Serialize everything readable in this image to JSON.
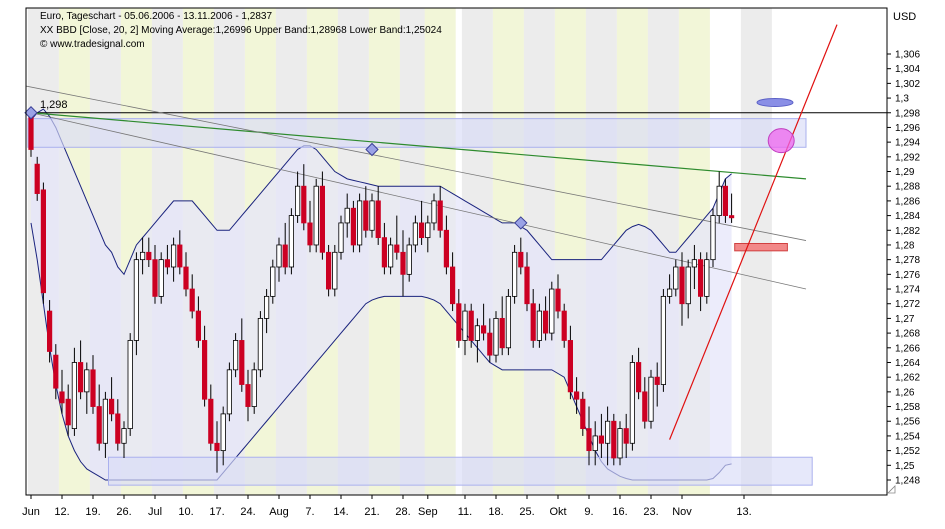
{
  "header": {
    "line1": "Euro, Tageschart - 05.06.2006 - 13.11.2006 - 1,2837",
    "line2": "XX BBD [Close, 20, 2] Moving Average:1,26996 Upper Band:1,28968 Lower Band:1,25024",
    "line3": "© www.tradesignal.com"
  },
  "currency_label": "USD",
  "level_label": "1,298",
  "colors": {
    "up": "#ffffff",
    "down": "#cc0022",
    "band": "#1a237e",
    "band_fill": "#e6e6fa",
    "stripe": "#ececec",
    "stripe_yellow": "#f2f6d8",
    "trend_green": "#2e8b2e",
    "trend_red": "#e01010",
    "trend_gray": "#777777",
    "level_line": "#000000",
    "box_blue": "#aab0ee",
    "ellipse_blue": "#8a8fe6",
    "ellipse_pink": "#ee66ee",
    "box_red": "#f28888"
  },
  "chart_data": {
    "type": "candlestick",
    "title": "Euro, Tageschart - 05.06.2006 - 13.11.2006 - 1,2837",
    "ylabel": "USD",
    "ylim": [
      1.247,
      1.309
    ],
    "y_ticks": [
      "1,306",
      "1,304",
      "1,302",
      "1,3",
      "1,298",
      "1,296",
      "1,294",
      "1,292",
      "1,29",
      "1,288",
      "1,286",
      "1,284",
      "1,282",
      "1,28",
      "1,278",
      "1,276",
      "1,274",
      "1,272",
      "1,27",
      "1,268",
      "1,266",
      "1,264",
      "1,262",
      "1,26",
      "1,258",
      "1,256",
      "1,254",
      "1,252",
      "1,25",
      "1,248"
    ],
    "x_ticks": [
      {
        "label": "Jun",
        "i": 0
      },
      {
        "label": "12.",
        "i": 5
      },
      {
        "label": "19.",
        "i": 10
      },
      {
        "label": "26.",
        "i": 15
      },
      {
        "label": "Jul",
        "i": 20
      },
      {
        "label": "10.",
        "i": 25
      },
      {
        "label": "17.",
        "i": 30
      },
      {
        "label": "24.",
        "i": 35
      },
      {
        "label": "Aug",
        "i": 40
      },
      {
        "label": "7.",
        "i": 45
      },
      {
        "label": "14.",
        "i": 50
      },
      {
        "label": "21.",
        "i": 55
      },
      {
        "label": "28.",
        "i": 60
      },
      {
        "label": "Sep",
        "i": 64
      },
      {
        "label": "11.",
        "i": 70
      },
      {
        "label": "18.",
        "i": 75
      },
      {
        "label": "25.",
        "i": 80
      },
      {
        "label": "Okt",
        "i": 85
      },
      {
        "label": "9.",
        "i": 90
      },
      {
        "label": "16.",
        "i": 95
      },
      {
        "label": "23.",
        "i": 100
      },
      {
        "label": "Nov",
        "i": 105
      },
      {
        "label": "13.",
        "i": 115
      }
    ],
    "candles": [
      [
        1.2975,
        1.298,
        1.292,
        1.293
      ],
      [
        1.291,
        1.292,
        1.286,
        1.287
      ],
      [
        1.2875,
        1.2885,
        1.272,
        1.2735
      ],
      [
        1.271,
        1.2725,
        1.264,
        1.2655
      ],
      [
        1.265,
        1.2665,
        1.259,
        1.2605
      ],
      [
        1.26,
        1.263,
        1.257,
        1.2585
      ],
      [
        1.259,
        1.261,
        1.254,
        1.2555
      ],
      [
        1.255,
        1.266,
        1.254,
        1.264
      ],
      [
        1.264,
        1.267,
        1.259,
        1.26
      ],
      [
        1.26,
        1.264,
        1.257,
        1.263
      ],
      [
        1.263,
        1.265,
        1.257,
        1.258
      ],
      [
        1.258,
        1.261,
        1.252,
        1.253
      ],
      [
        1.253,
        1.26,
        1.251,
        1.259
      ],
      [
        1.259,
        1.262,
        1.256,
        1.257
      ],
      [
        1.257,
        1.259,
        1.252,
        1.253
      ],
      [
        1.253,
        1.256,
        1.251,
        1.255
      ],
      [
        1.255,
        1.268,
        1.254,
        1.267
      ],
      [
        1.267,
        1.279,
        1.265,
        1.278
      ],
      [
        1.278,
        1.281,
        1.276,
        1.279
      ],
      [
        1.279,
        1.281,
        1.277,
        1.278
      ],
      [
        1.278,
        1.28,
        1.272,
        1.273
      ],
      [
        1.273,
        1.279,
        1.272,
        1.278
      ],
      [
        1.278,
        1.28,
        1.276,
        1.277
      ],
      [
        1.277,
        1.281,
        1.275,
        1.28
      ],
      [
        1.28,
        1.282,
        1.276,
        1.277
      ],
      [
        1.277,
        1.279,
        1.273,
        1.274
      ],
      [
        1.274,
        1.276,
        1.27,
        1.271
      ],
      [
        1.271,
        1.273,
        1.266,
        1.267
      ],
      [
        1.267,
        1.269,
        1.258,
        1.259
      ],
      [
        1.259,
        1.261,
        1.252,
        1.253
      ],
      [
        1.253,
        1.256,
        1.249,
        1.252
      ],
      [
        1.252,
        1.258,
        1.25,
        1.257
      ],
      [
        1.257,
        1.264,
        1.256,
        1.263
      ],
      [
        1.263,
        1.268,
        1.262,
        1.267
      ],
      [
        1.267,
        1.27,
        1.26,
        1.261
      ],
      [
        1.261,
        1.263,
        1.256,
        1.258
      ],
      [
        1.258,
        1.264,
        1.257,
        1.263
      ],
      [
        1.263,
        1.271,
        1.262,
        1.27
      ],
      [
        1.27,
        1.274,
        1.268,
        1.273
      ],
      [
        1.273,
        1.278,
        1.272,
        1.277
      ],
      [
        1.277,
        1.281,
        1.275,
        1.28
      ],
      [
        1.28,
        1.283,
        1.276,
        1.277
      ],
      [
        1.277,
        1.285,
        1.276,
        1.284
      ],
      [
        1.284,
        1.29,
        1.283,
        1.288
      ],
      [
        1.288,
        1.291,
        1.282,
        1.283
      ],
      [
        1.283,
        1.286,
        1.279,
        1.28
      ],
      [
        1.28,
        1.289,
        1.279,
        1.288
      ],
      [
        1.288,
        1.29,
        1.278,
        1.279
      ],
      [
        1.279,
        1.28,
        1.273,
        1.274
      ],
      [
        1.274,
        1.28,
        1.273,
        1.279
      ],
      [
        1.279,
        1.284,
        1.278,
        1.283
      ],
      [
        1.283,
        1.287,
        1.281,
        1.285
      ],
      [
        1.285,
        1.286,
        1.279,
        1.28
      ],
      [
        1.28,
        1.287,
        1.279,
        1.286
      ],
      [
        1.286,
        1.288,
        1.281,
        1.282
      ],
      [
        1.282,
        1.287,
        1.281,
        1.286
      ],
      [
        1.286,
        1.288,
        1.28,
        1.281
      ],
      [
        1.281,
        1.283,
        1.276,
        1.277
      ],
      [
        1.277,
        1.281,
        1.276,
        1.28
      ],
      [
        1.28,
        1.284,
        1.278,
        1.279
      ],
      [
        1.279,
        1.282,
        1.273,
        1.276
      ],
      [
        1.276,
        1.281,
        1.275,
        1.28
      ],
      [
        1.28,
        1.284,
        1.279,
        1.283
      ],
      [
        1.283,
        1.286,
        1.28,
        1.281
      ],
      [
        1.281,
        1.284,
        1.279,
        1.283
      ],
      [
        1.283,
        1.287,
        1.282,
        1.286
      ],
      [
        1.286,
        1.288,
        1.281,
        1.282
      ],
      [
        1.282,
        1.284,
        1.276,
        1.277
      ],
      [
        1.277,
        1.279,
        1.271,
        1.272
      ],
      [
        1.272,
        1.274,
        1.266,
        1.267
      ],
      [
        1.267,
        1.272,
        1.265,
        1.271
      ],
      [
        1.271,
        1.272,
        1.266,
        1.267
      ],
      [
        1.267,
        1.27,
        1.264,
        1.269
      ],
      [
        1.269,
        1.272,
        1.267,
        1.268
      ],
      [
        1.268,
        1.27,
        1.264,
        1.265
      ],
      [
        1.265,
        1.271,
        1.264,
        1.27
      ],
      [
        1.27,
        1.273,
        1.265,
        1.266
      ],
      [
        1.266,
        1.274,
        1.265,
        1.273
      ],
      [
        1.273,
        1.28,
        1.272,
        1.279
      ],
      [
        1.279,
        1.281,
        1.276,
        1.277
      ],
      [
        1.277,
        1.279,
        1.271,
        1.272
      ],
      [
        1.272,
        1.274,
        1.266,
        1.267
      ],
      [
        1.267,
        1.272,
        1.266,
        1.271
      ],
      [
        1.271,
        1.273,
        1.267,
        1.268
      ],
      [
        1.268,
        1.275,
        1.267,
        1.274
      ],
      [
        1.274,
        1.276,
        1.27,
        1.271
      ],
      [
        1.271,
        1.272,
        1.266,
        1.267
      ],
      [
        1.267,
        1.269,
        1.259,
        1.26
      ],
      [
        1.26,
        1.262,
        1.257,
        1.259
      ],
      [
        1.259,
        1.26,
        1.254,
        1.255
      ],
      [
        1.255,
        1.258,
        1.25,
        1.252
      ],
      [
        1.252,
        1.256,
        1.25,
        1.254
      ],
      [
        1.254,
        1.257,
        1.251,
        1.253
      ],
      [
        1.253,
        1.258,
        1.25,
        1.256
      ],
      [
        1.256,
        1.257,
        1.25,
        1.251
      ],
      [
        1.251,
        1.256,
        1.25,
        1.255
      ],
      [
        1.255,
        1.257,
        1.251,
        1.253
      ],
      [
        1.253,
        1.265,
        1.252,
        1.264
      ],
      [
        1.264,
        1.266,
        1.259,
        1.26
      ],
      [
        1.26,
        1.262,
        1.255,
        1.256
      ],
      [
        1.256,
        1.263,
        1.255,
        1.262
      ],
      [
        1.262,
        1.264,
        1.258,
        1.261
      ],
      [
        1.261,
        1.274,
        1.26,
        1.273
      ],
      [
        1.273,
        1.276,
        1.272,
        1.274
      ],
      [
        1.274,
        1.278,
        1.273,
        1.277
      ],
      [
        1.277,
        1.279,
        1.269,
        1.272
      ],
      [
        1.272,
        1.278,
        1.27,
        1.277
      ],
      [
        1.277,
        1.28,
        1.274,
        1.278
      ],
      [
        1.278,
        1.279,
        1.271,
        1.273
      ],
      [
        1.273,
        1.279,
        1.272,
        1.278
      ],
      [
        1.278,
        1.285,
        1.277,
        1.284
      ],
      [
        1.284,
        1.29,
        1.283,
        1.288
      ],
      [
        1.288,
        1.289,
        1.283,
        1.284
      ],
      [
        1.284,
        1.287,
        1.283,
        1.2837
      ]
    ],
    "upper_band": [
      1.297,
      1.298,
      1.2985,
      1.2975,
      1.296,
      1.294,
      1.292,
      1.29,
      1.288,
      1.286,
      1.284,
      1.282,
      1.28,
      1.279,
      1.277,
      1.276,
      1.278,
      1.28,
      1.281,
      1.282,
      1.283,
      1.284,
      1.285,
      1.286,
      1.286,
      1.286,
      1.286,
      1.285,
      1.284,
      1.283,
      1.282,
      1.282,
      1.282,
      1.283,
      1.284,
      1.285,
      1.286,
      1.287,
      1.288,
      1.289,
      1.29,
      1.291,
      1.292,
      1.293,
      1.2935,
      1.2935,
      1.293,
      1.292,
      1.291,
      1.29,
      1.2895,
      1.289,
      1.2888,
      1.2886,
      1.2884,
      1.2882,
      1.288,
      1.288,
      1.288,
      1.288,
      1.288,
      1.288,
      1.288,
      1.288,
      1.288,
      1.288,
      1.288,
      1.2875,
      1.287,
      1.2865,
      1.286,
      1.2855,
      1.285,
      1.2845,
      1.284,
      1.2835,
      1.283,
      1.283,
      1.283,
      1.2825,
      1.282,
      1.281,
      1.28,
      1.279,
      1.278,
      1.278,
      1.278,
      1.278,
      1.278,
      1.278,
      1.278,
      1.278,
      1.278,
      1.279,
      1.28,
      1.281,
      1.282,
      1.2825,
      1.2828,
      1.2825,
      1.282,
      1.281,
      1.28,
      1.279,
      1.279,
      1.28,
      1.281,
      1.282,
      1.283,
      1.284,
      1.285,
      1.287,
      1.289,
      1.2897
    ],
    "lower_band": [
      1.283,
      1.278,
      1.272,
      1.266,
      1.261,
      1.257,
      1.254,
      1.252,
      1.2505,
      1.2495,
      1.249,
      1.2485,
      1.248,
      1.248,
      1.248,
      1.248,
      1.248,
      1.248,
      1.248,
      1.248,
      1.248,
      1.248,
      1.248,
      1.248,
      1.248,
      1.248,
      1.248,
      1.248,
      1.248,
      1.248,
      1.248,
      1.249,
      1.25,
      1.251,
      1.252,
      1.253,
      1.254,
      1.255,
      1.256,
      1.257,
      1.258,
      1.259,
      1.26,
      1.261,
      1.262,
      1.263,
      1.264,
      1.265,
      1.266,
      1.267,
      1.268,
      1.269,
      1.27,
      1.271,
      1.272,
      1.2725,
      1.2728,
      1.273,
      1.273,
      1.273,
      1.273,
      1.273,
      1.273,
      1.273,
      1.2728,
      1.2725,
      1.272,
      1.271,
      1.27,
      1.269,
      1.268,
      1.267,
      1.266,
      1.265,
      1.264,
      1.2635,
      1.263,
      1.263,
      1.263,
      1.263,
      1.263,
      1.263,
      1.263,
      1.263,
      1.263,
      1.2625,
      1.262,
      1.26,
      1.258,
      1.256,
      1.254,
      1.252,
      1.2505,
      1.2495,
      1.249,
      1.2485,
      1.2482,
      1.248,
      1.248,
      1.248,
      1.248,
      1.248,
      1.248,
      1.248,
      1.248,
      1.248,
      1.248,
      1.248,
      1.248,
      1.248,
      1.2482,
      1.249,
      1.25,
      1.2502
    ],
    "level_line": 1.298,
    "trendlines": [
      {
        "color": "green",
        "from": [
          0,
          1.298
        ],
        "to": [
          125,
          1.289
        ]
      },
      {
        "color": "gray",
        "from": [
          -3,
          1.302
        ],
        "to": [
          125,
          1.2806
        ]
      },
      {
        "color": "gray",
        "from": [
          0,
          1.298
        ],
        "to": [
          125,
          1.274
        ]
      },
      {
        "color": "red",
        "from": [
          103,
          1.2535
        ],
        "to": [
          130,
          1.31
        ]
      }
    ],
    "markers": [
      {
        "shape": "diamond",
        "i": 0,
        "y": 1.298
      },
      {
        "shape": "diamond",
        "i": 55,
        "y": 1.293
      },
      {
        "shape": "diamond",
        "i": 79,
        "y": 1.283
      }
    ],
    "zones": [
      {
        "color": "blue",
        "from_i": 0,
        "to_i": 125,
        "y1": 1.2972,
        "y2": 1.2933
      },
      {
        "color": "blue",
        "from_i": 13,
        "to_i": 126,
        "y1": 1.2511,
        "y2": 1.2473
      },
      {
        "color": "red",
        "from_i": 114,
        "to_i": 122,
        "y1": 1.2802,
        "y2": 1.2792
      }
    ],
    "ellipses": [
      {
        "color": "blue",
        "i": 120,
        "y": 1.2994
      },
      {
        "color": "pink",
        "i": 121,
        "y": 1.2942
      }
    ]
  }
}
